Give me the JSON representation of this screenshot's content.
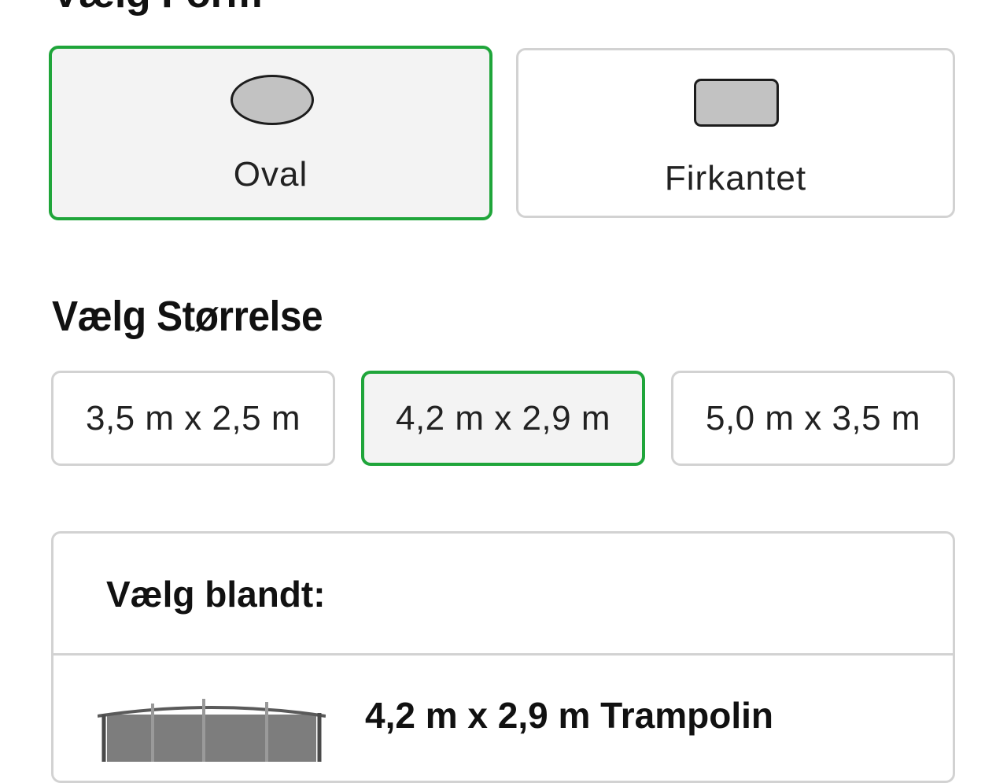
{
  "form_section": {
    "heading": "Vælg Form",
    "options": [
      {
        "label": "Oval",
        "icon": "oval-shape-icon",
        "selected": true
      },
      {
        "label": "Firkantet",
        "icon": "rounded-rectangle-shape-icon",
        "selected": false
      }
    ]
  },
  "size_section": {
    "heading": "Vælg Størrelse",
    "options": [
      {
        "label": "3,5 m x 2,5 m",
        "selected": false
      },
      {
        "label": "4,2 m x 2,9 m",
        "selected": true
      },
      {
        "label": "5,0 m x 3,5 m",
        "selected": false
      }
    ]
  },
  "mix_panel": {
    "title": "Vælg blandt:",
    "product": {
      "title": "4,2 m x 2,9 m Trampolin",
      "image_icon": "trampoline-product-image"
    }
  },
  "colors": {
    "selected_border": "#1fa53a",
    "selected_background": "#f3f3f3",
    "default_border": "#d2d2d2",
    "shape_fill": "#c2c2c2",
    "text": "#111111"
  }
}
